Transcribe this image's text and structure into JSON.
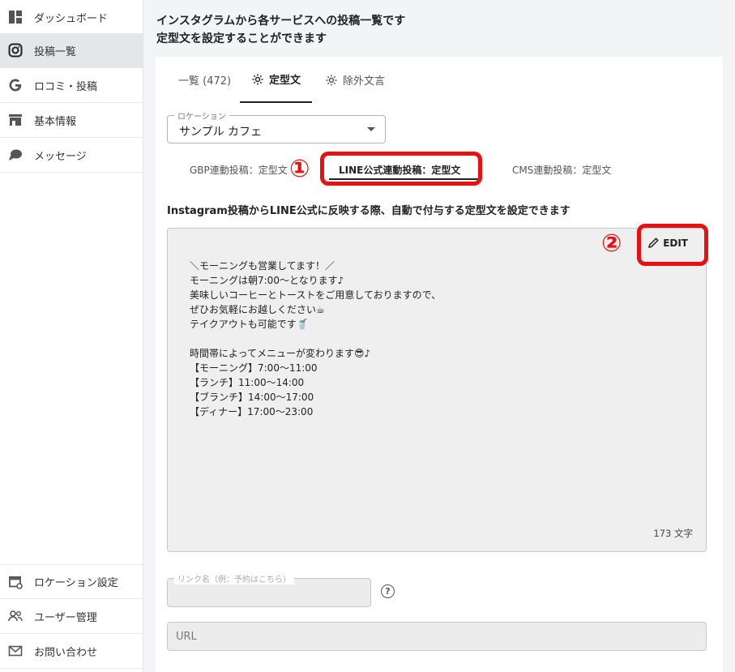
{
  "sidebar": {
    "items": [
      {
        "label": "ダッシュボード",
        "icon": "dashboard-icon"
      },
      {
        "label": "投稿一覧",
        "icon": "instagram-icon",
        "active": true
      },
      {
        "label": "ロコミ・投稿",
        "icon": "google-icon"
      },
      {
        "label": "基本情報",
        "icon": "store-icon"
      },
      {
        "label": "メッセージ",
        "icon": "chat-icon"
      }
    ],
    "bottom_items": [
      {
        "label": "ロケーション設定",
        "icon": "store-settings-icon"
      },
      {
        "label": "ユーザー管理",
        "icon": "users-icon"
      },
      {
        "label": "お問い合わせ",
        "icon": "mail-icon"
      }
    ]
  },
  "header": {
    "line1": "インスタグラムから各サービスへの投稿一覧です",
    "line2": "定型文を設定することができます"
  },
  "tabs": [
    {
      "label": "一覧 (472)",
      "icon": null
    },
    {
      "label": "定型文",
      "icon": "gear-icon",
      "active": true
    },
    {
      "label": "除外文言",
      "icon": "gear-icon"
    }
  ],
  "location": {
    "legend": "ロケーション",
    "value": "サンプル カフェ"
  },
  "subtabs": [
    {
      "label": "GBP連動投稿：定型文"
    },
    {
      "label": "LINE公式連動投稿：定型文",
      "active": true
    },
    {
      "label": "CMS連動投稿：定型文"
    }
  ],
  "annotations": {
    "marker1": "①",
    "marker2": "②",
    "highlight_color": "#e81010"
  },
  "description": "Instagram投稿からLINE公式に反映する際、自動で付与する定型文を設定できます",
  "template": {
    "lines": [
      "＼モーニングも営業してます！／",
      "モーニングは朝7:00〜となります♪",
      "美味しいコーヒーとトーストをご用意しておりますので、",
      "ぜひお気軽にお越しください☕",
      "テイクアウトも可能です🥤",
      "",
      "時間帯によってメニューが変わります😎♪",
      "【モーニング】7:00〜11:00",
      "【ランチ】11:00〜14:00",
      "【ブランチ】14:00〜17:00",
      "【ディナー】17:00〜23:00"
    ],
    "edit_label": "EDIT",
    "char_count": "173 文字"
  },
  "link": {
    "legend": "リンク名（例：予約はこちら）",
    "help": "?"
  },
  "url": {
    "placeholder": "URL"
  }
}
